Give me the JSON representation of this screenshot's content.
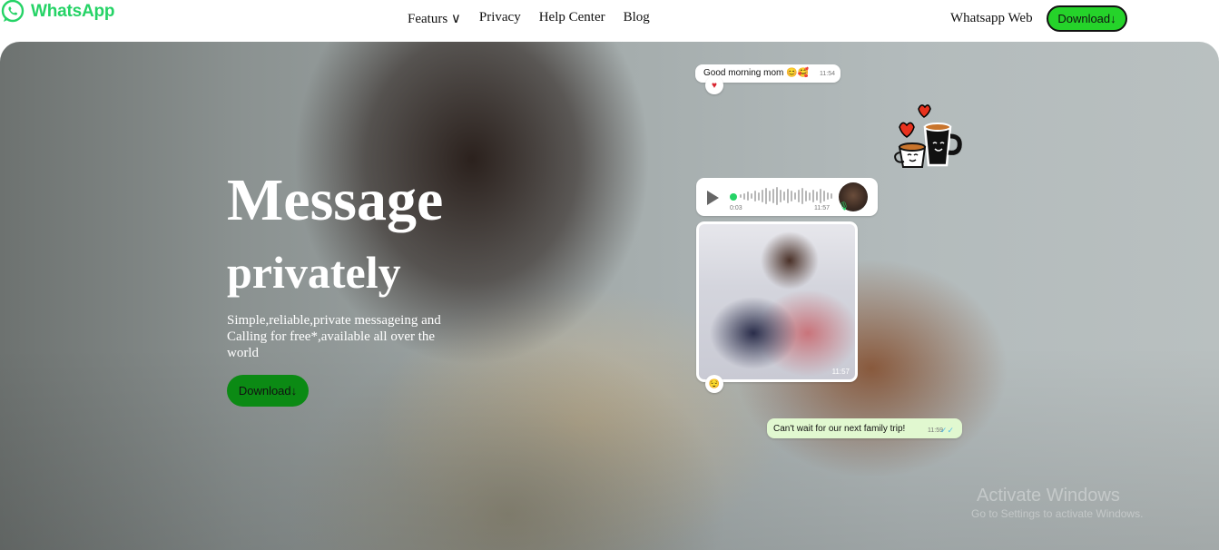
{
  "brand": {
    "name": "WhatsApp",
    "color": "#25d366",
    "icon": "whatsapp-logo-icon"
  },
  "nav": {
    "items": [
      {
        "label": "Featurs ∨"
      },
      {
        "label": "Privacy"
      },
      {
        "label": "Help Center"
      },
      {
        "label": "Blog"
      }
    ],
    "web_link": "Whatsapp Web",
    "download_label": "Download↓"
  },
  "hero": {
    "title": "Message",
    "subtitle": "privately",
    "description": "Simple,reliable,private messageing and Calling for free*,available all over the world",
    "download_label": "Download↓",
    "button_color": "#0b8a14"
  },
  "chat": {
    "greeting": {
      "text": "Good morning mom 😊🥰",
      "time": "11:54",
      "reaction": "♥"
    },
    "voice_note": {
      "duration": "0:03",
      "time": "11:57",
      "icon": "play-icon"
    },
    "photo_message": {
      "time": "11:57",
      "reaction": "😌"
    },
    "trip_message": {
      "text": "Can't wait for our next family trip!",
      "time": "11:59",
      "ticks": "✓✓"
    }
  },
  "sticker": {
    "icon": "coffee-cups-hearts-sticker"
  },
  "watermark": {
    "line1": "Activate Windows",
    "line2": "Go to Settings to activate Windows."
  }
}
